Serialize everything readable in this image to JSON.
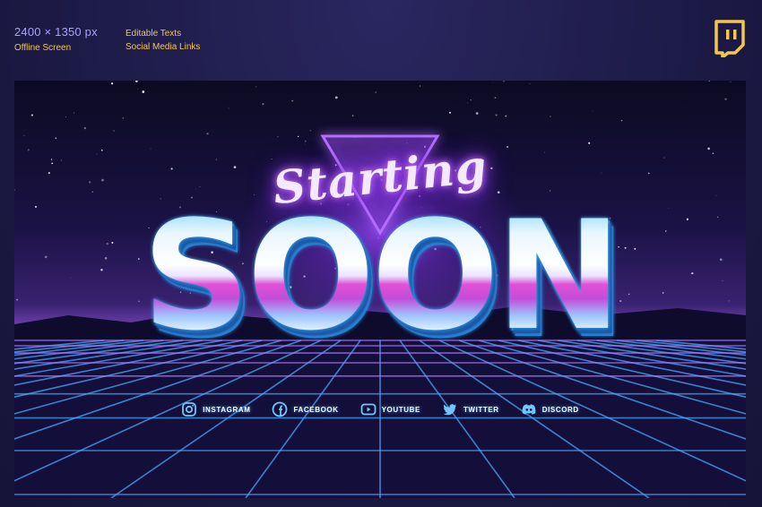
{
  "header": {
    "dimensions": "2400 × 1350 px",
    "subtitle": "Offline Screen",
    "features": [
      "Editable Texts",
      "Social Media Links"
    ]
  },
  "logo": {
    "icon": "twitch-icon"
  },
  "banner": {
    "script_title": "Starting",
    "main_title": "SOON",
    "social": [
      {
        "icon": "instagram-icon",
        "label": "INSTAGRAM"
      },
      {
        "icon": "facebook-icon",
        "label": "FACEBOOK"
      },
      {
        "icon": "youtube-icon",
        "label": "YOUTUBE"
      },
      {
        "icon": "twitter-icon",
        "label": "TWITTER"
      },
      {
        "icon": "discord-icon",
        "label": "DISCORD"
      }
    ]
  },
  "colors": {
    "accent_yellow": "#f2c84b",
    "neon_blue": "#36a0ff",
    "neon_purple": "#9b3ff0",
    "pink": "#e24fd8"
  }
}
